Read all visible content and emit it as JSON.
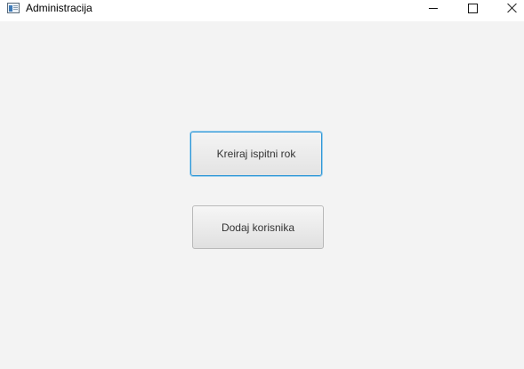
{
  "window": {
    "title": "Administracija",
    "icon": "app-window-icon",
    "controls": {
      "minimize": "minimize-icon",
      "maximize": "maximize-icon",
      "close": "close-icon"
    }
  },
  "main": {
    "buttons": [
      {
        "label": "Kreiraj ispitni rok",
        "focused": true
      },
      {
        "label": "Dodaj korisnika",
        "focused": false
      }
    ]
  },
  "colors": {
    "background": "#f3f3f3",
    "titlebar": "#ffffff",
    "focus_border": "#2b95d6",
    "button_text": "#333333"
  }
}
